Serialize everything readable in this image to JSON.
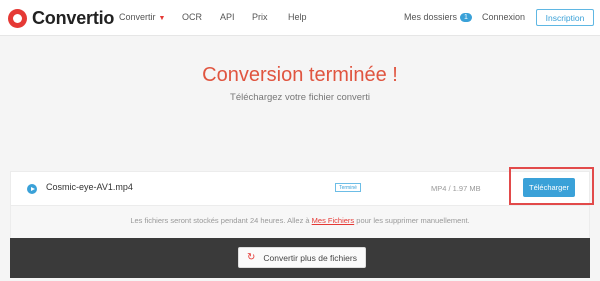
{
  "header": {
    "logo_text": "Convertio",
    "nav": [
      {
        "label": "Convertir"
      },
      {
        "label": "OCR"
      },
      {
        "label": "API"
      },
      {
        "label": "Prix"
      },
      {
        "label": "Help"
      }
    ],
    "my_files_label": "Mes dossiers",
    "my_files_count": "1",
    "login_label": "Connexion",
    "signup_label": "Inscription"
  },
  "hero": {
    "title": "Conversion terminée !",
    "subtitle": "Téléchargez votre fichier converti"
  },
  "file": {
    "name": "Cosmic-eye-AV1.mp4",
    "status": "Terminé",
    "size": "MP4 / 1.97 MB",
    "download_label": "Télécharger"
  },
  "notice": {
    "text_before": "Les fichiers seront stockés pendant 24 heures. Allez à ",
    "link": "Mes Fichiers",
    "text_after": " pour les supprimer manuellement."
  },
  "footer": {
    "convert_more_label": "Convertir plus de fichiers"
  },
  "colors": {
    "brand_red": "#e53935",
    "accent_blue": "#3aa1d8",
    "dark_bar": "#3a3a3a"
  },
  "icons": {
    "logo": "convertio-logo-icon",
    "play": "play-icon",
    "caret": "chevron-down-icon",
    "refresh": "refresh-icon"
  }
}
